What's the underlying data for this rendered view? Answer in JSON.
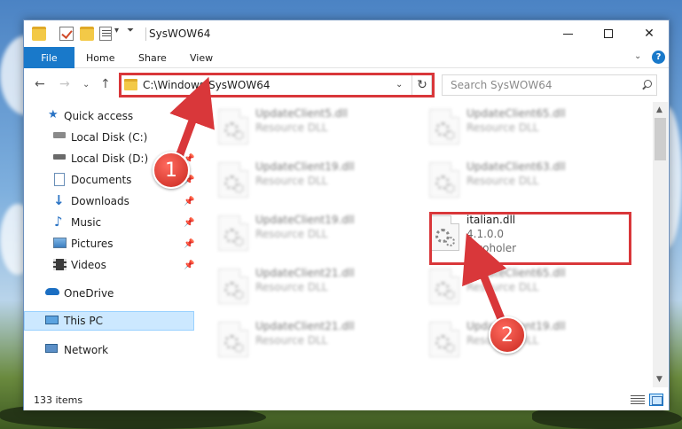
{
  "window": {
    "title": "SysWOW64"
  },
  "ribbon": {
    "tabs": [
      "File",
      "Home",
      "Share",
      "View"
    ],
    "help": "?"
  },
  "address": {
    "path": "C:\\Windows\\SysWOW64",
    "search_placeholder": "Search SysWOW64"
  },
  "sidebar": {
    "quick_access": "Quick access",
    "pinned": [
      {
        "label": "Local Disk (C:)",
        "icon": "drive-icon"
      },
      {
        "label": "Local Disk (D:)",
        "icon": "drive-icon"
      },
      {
        "label": "Documents",
        "icon": "documents-icon"
      },
      {
        "label": "Downloads",
        "icon": "downloads-icon"
      },
      {
        "label": "Music",
        "icon": "music-icon"
      },
      {
        "label": "Pictures",
        "icon": "pictures-icon"
      },
      {
        "label": "Videos",
        "icon": "videos-icon"
      }
    ],
    "onedrive": "OneDrive",
    "this_pc": "This PC",
    "network": "Network"
  },
  "files": {
    "left": [
      {
        "name": "UpdateClient5.dll",
        "desc": "Resource DLL"
      },
      {
        "name": "UpdateClient19.dll",
        "desc": "Resource DLL"
      },
      {
        "name": "UpdateClient19.dll",
        "desc": "Resource DLL"
      },
      {
        "name": "UpdateClient21.dll",
        "desc": "Resource DLL"
      },
      {
        "name": "UpdateClient21.dll",
        "desc": "Resource DLL"
      }
    ],
    "right": [
      {
        "name": "UpdateClient65.dll",
        "desc": "Resource DLL"
      },
      {
        "name": "UpdateClient63.dll",
        "desc": "Resource DLL"
      },
      {
        "name": "UpdateClient65.dll",
        "desc": "Resource DLL"
      },
      {
        "name": "UpdateClient19.dll",
        "desc": "Resource DLL"
      }
    ],
    "highlighted": {
      "name": "italian.dll",
      "version": "4.1.0.0",
      "company": "Alcoholer"
    }
  },
  "status": {
    "items": "133 items"
  },
  "annotations": {
    "badge1": "1",
    "badge2": "2",
    "color": "#d9373a"
  }
}
